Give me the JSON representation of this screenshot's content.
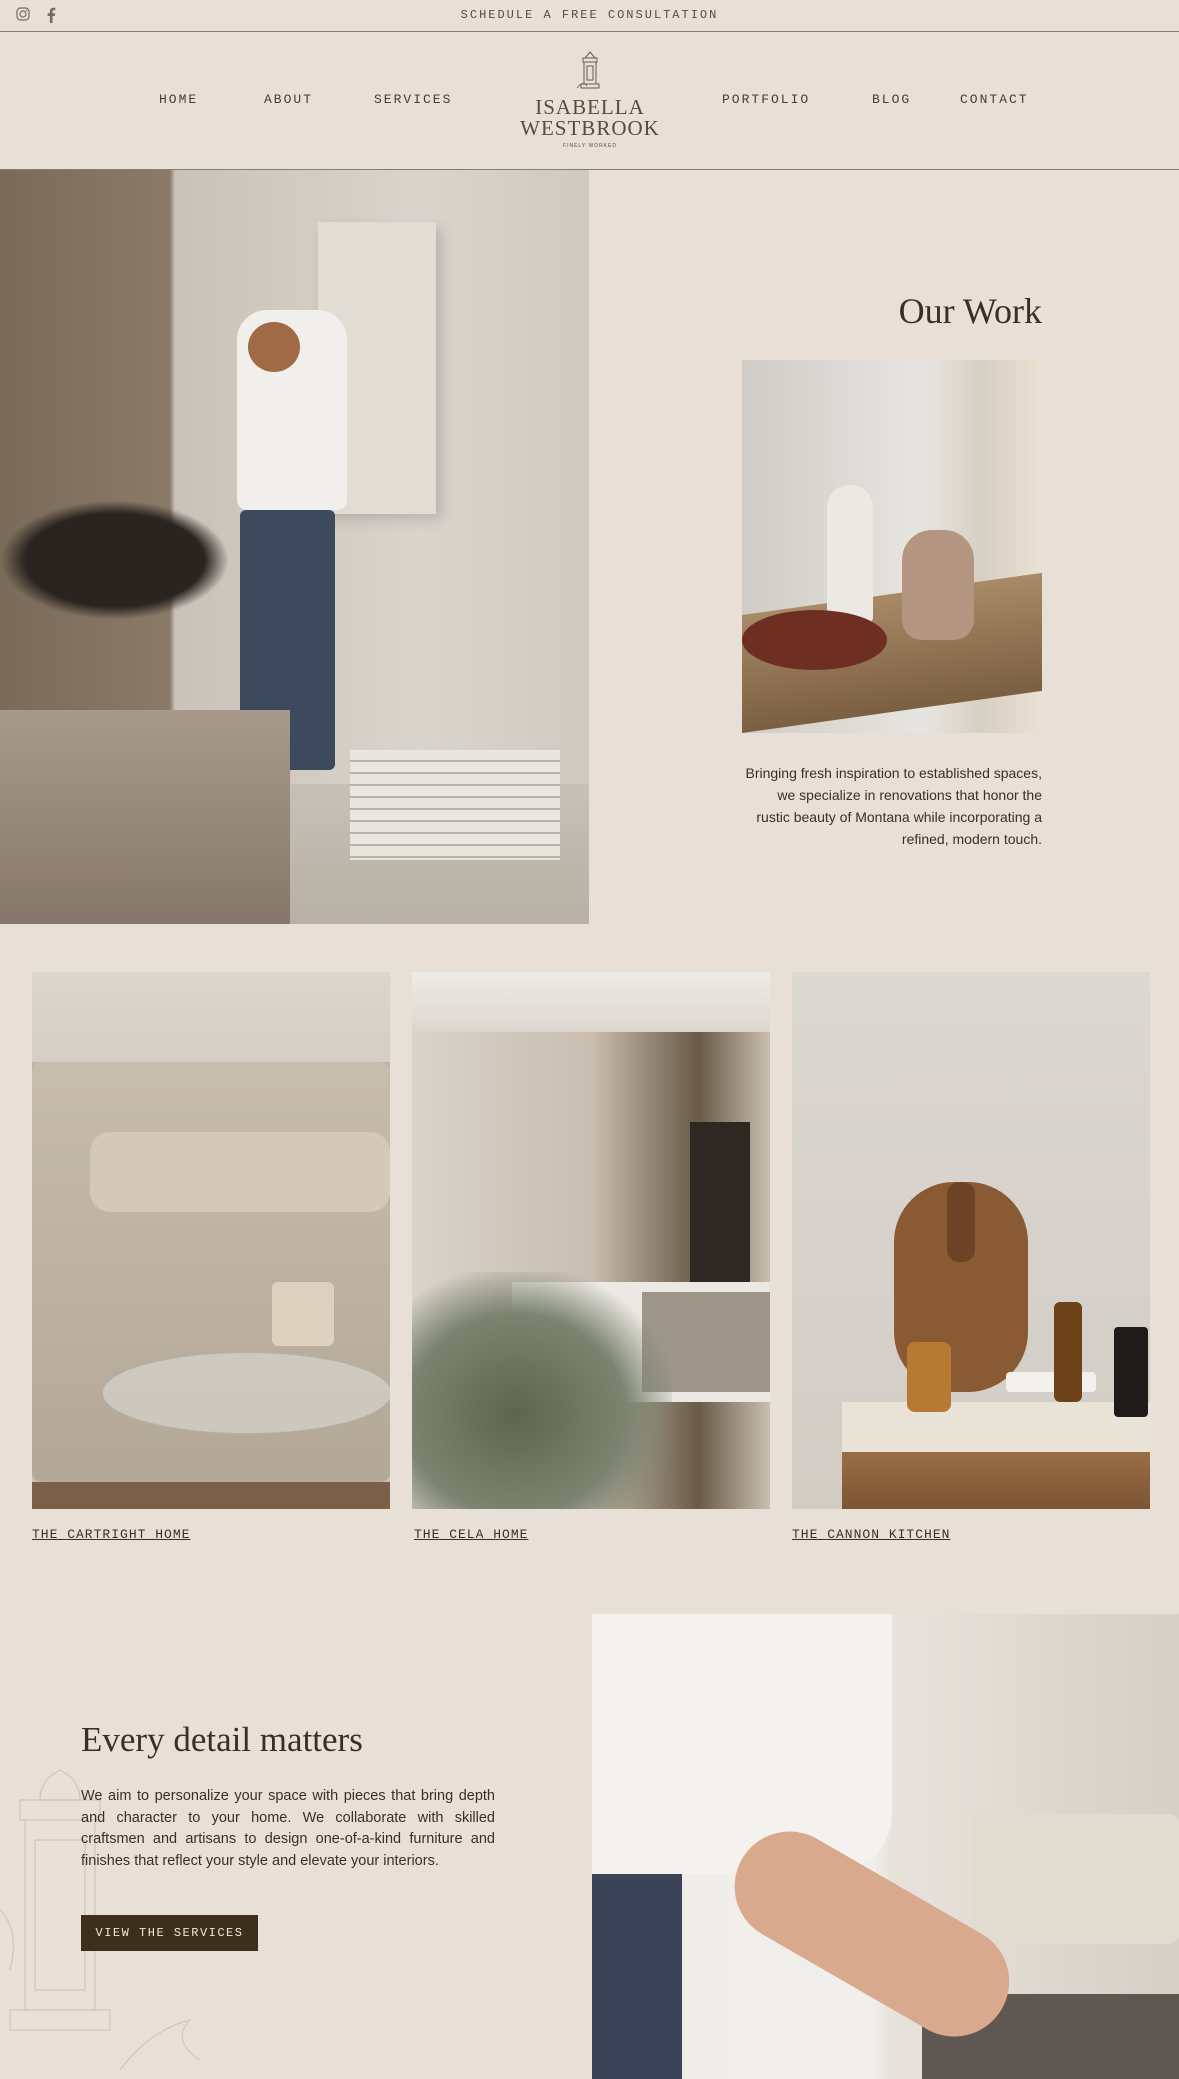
{
  "topbar": {
    "cta": "SCHEDULE A FREE CONSULTATION",
    "social": [
      {
        "icon": "instagram-icon"
      },
      {
        "icon": "facebook-icon"
      }
    ]
  },
  "nav": {
    "home": "HOME",
    "about": "ABOUT",
    "services": "SERVICES",
    "portfolio": "PORTFOLIO",
    "blog": "BLOG",
    "contact": "CONTACT"
  },
  "logo": {
    "line1": "ISABELLA",
    "line2": "WESTBROOK",
    "tagline": "FINELY WORKED"
  },
  "our_work": {
    "title": "Our Work",
    "text": "Bringing fresh inspiration to established spaces, we specialize in renovations that honor the rustic beauty of Montana while incorporating a refined, modern touch."
  },
  "projects": [
    {
      "name": "THE CARTRIGHT HOME"
    },
    {
      "name": "THE CELA HOME"
    },
    {
      "name": "THE CANNON KITCHEN"
    }
  ],
  "detail": {
    "title": "Every detail matters",
    "text": "We aim to personalize your space with pieces that bring depth and character to your home. We collaborate with skilled craftsmen and artisans to design one-of-a-kind furniture and finishes that reflect your style and elevate your interiors.",
    "button": "VIEW THE SERVICES"
  },
  "colors": {
    "background": "#e8e0d6",
    "text": "#3b2f24",
    "button": "#3e2e1c"
  }
}
